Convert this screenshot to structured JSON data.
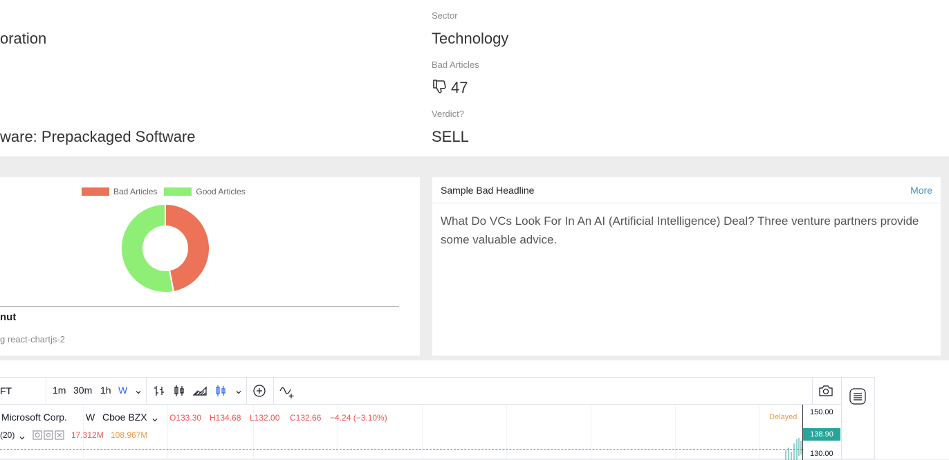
{
  "info": {
    "name_partial": "oration",
    "industry_partial": "ware: Prepackaged Software",
    "sector_label": "Sector",
    "sector_value": "Technology",
    "bad_articles_label": "Bad Articles",
    "bad_articles_value": "47",
    "verdict_label": "Verdict?",
    "verdict_value": "SELL"
  },
  "chart_card": {
    "caption_title": "nut",
    "caption_sub": "g react-chartjs-2"
  },
  "chart_data": {
    "type": "pie",
    "variant": "doughnut",
    "labels": [
      "Bad Articles",
      "Good Articles"
    ],
    "values": [
      47,
      53
    ],
    "colors": [
      "#ec7357",
      "#8fee76"
    ],
    "legend_position": "top"
  },
  "headline": {
    "title": "Sample Bad Headline",
    "more": "More",
    "text": "What Do VCs Look For In An AI (Artificial Intelligence) Deal? Three venture partners provide some valuable advice."
  },
  "tv": {
    "symbol": "FT",
    "intervals": [
      "1m",
      "30m",
      "1h",
      "W"
    ],
    "active_interval": "W",
    "legend_name": "Microsoft Corp.",
    "legend_interval": "W",
    "legend_exchange": "Cboe BZX",
    "open": "O133.30",
    "high": "H134.68",
    "low": "L132.00",
    "close": "C132.66",
    "change": "−4.24 (−3.10%)",
    "vol_label": "(20)",
    "vol1": "17.312M",
    "vol2": "108.967M",
    "delayed": "Delayed",
    "price_150": "150.00",
    "price_current": "138.90",
    "price_130": "130.00",
    "colors": {
      "up": "#26a69a",
      "down": "#ef5350",
      "accent": "#2962ff"
    }
  }
}
